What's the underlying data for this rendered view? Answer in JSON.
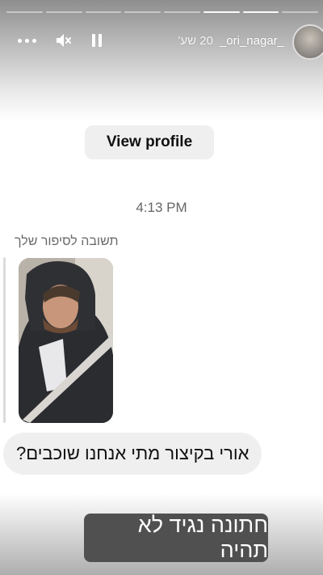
{
  "story": {
    "username": "_ori_nagar_",
    "time_ago": "20 שע'",
    "progress_done": 2,
    "progress_total": 8
  },
  "controls": {
    "more_icon": "more-dots-icon",
    "mute_icon": "muted-speaker-icon",
    "pause_icon": "pause-icon"
  },
  "dm": {
    "view_profile_label": "View profile",
    "timestamp": "4:13 PM",
    "reply_caption": "תשובה לסיפור שלך",
    "message": "אורי בקיצור מתי אנחנו שוכבים?"
  },
  "overlay": {
    "caption": "חתונה נגיד לא תהיה"
  },
  "colors": {
    "bubble_bg": "#efefef",
    "caption_bg": "#505050",
    "secondary_text": "#666666"
  }
}
